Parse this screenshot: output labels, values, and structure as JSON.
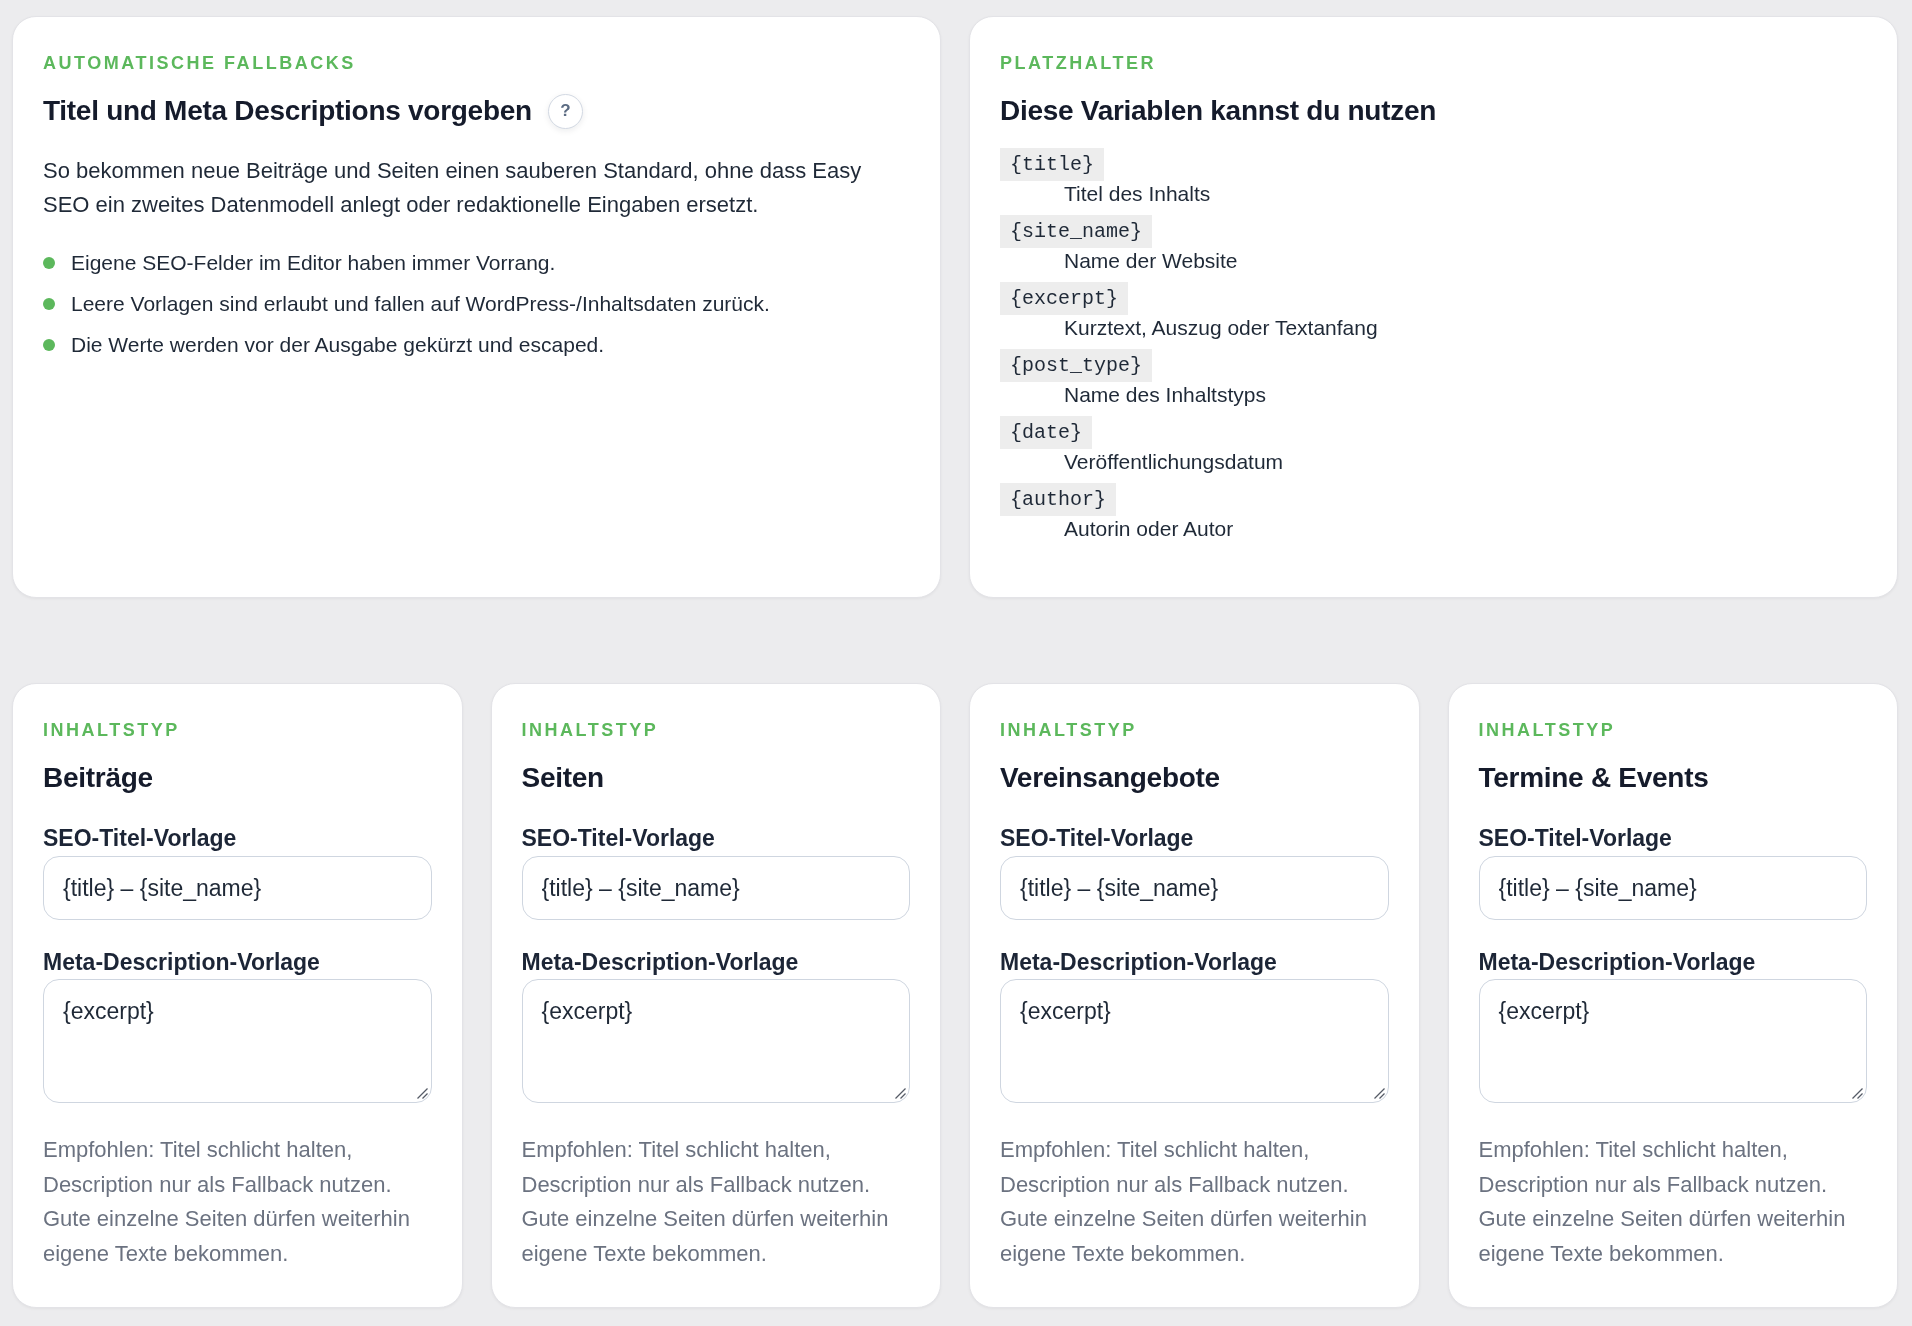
{
  "fallbacks_card": {
    "eyebrow": "AUTOMATISCHE FALLBACKS",
    "title": "Titel und Meta Descriptions vorgeben",
    "help_button": "?",
    "intro": "So bekommen neue Beiträge und Seiten einen sauberen Standard, ohne dass Easy SEO ein zweites Datenmodell anlegt oder redaktionelle Eingaben ersetzt.",
    "bullets": [
      "Eigene SEO-Felder im Editor haben immer Vorrang.",
      "Leere Vorlagen sind erlaubt und fallen auf WordPress-/Inhaltsdaten zurück.",
      "Die Werte werden vor der Ausgabe gekürzt und escaped."
    ]
  },
  "placeholders_card": {
    "eyebrow": "PLATZHALTER",
    "title": "Diese Variablen kannst du nutzen",
    "variables": [
      {
        "code": "{title}",
        "description": "Titel des Inhalts"
      },
      {
        "code": "{site_name}",
        "description": "Name der Website"
      },
      {
        "code": "{excerpt}",
        "description": "Kurztext, Auszug oder Textanfang"
      },
      {
        "code": "{post_type}",
        "description": "Name des Inhaltstyps"
      },
      {
        "code": "{date}",
        "description": "Veröffentlichungsdatum"
      },
      {
        "code": "{author}",
        "description": "Autorin oder Autor"
      }
    ]
  },
  "post_types": [
    {
      "eyebrow": "INHALTSTYP",
      "title": "Beiträge",
      "title_field": {
        "label": "SEO-Titel-Vorlage",
        "value": "{title} – {site_name}"
      },
      "description_field": {
        "label": "Meta-Description-Vorlage",
        "value": "{excerpt}"
      },
      "hint": "Empfohlen: Titel schlicht halten, Description nur als Fallback nutzen. Gute einzelne Seiten dürfen weiterhin eigene Texte bekommen."
    },
    {
      "eyebrow": "INHALTSTYP",
      "title": "Seiten",
      "title_field": {
        "label": "SEO-Titel-Vorlage",
        "value": "{title} – {site_name}"
      },
      "description_field": {
        "label": "Meta-Description-Vorlage",
        "value": "{excerpt}"
      },
      "hint": "Empfohlen: Titel schlicht halten, Description nur als Fallback nutzen. Gute einzelne Seiten dürfen weiterhin eigene Texte bekommen."
    },
    {
      "eyebrow": "INHALTSTYP",
      "title": "Vereinsangebote",
      "title_field": {
        "label": "SEO-Titel-Vorlage",
        "value": "{title} – {site_name}"
      },
      "description_field": {
        "label": "Meta-Description-Vorlage",
        "value": "{excerpt}"
      },
      "hint": "Empfohlen: Titel schlicht halten, Description nur als Fallback nutzen. Gute einzelne Seiten dürfen weiterhin eigene Texte bekommen."
    },
    {
      "eyebrow": "INHALTSTYP",
      "title": "Termine & Events",
      "title_field": {
        "label": "SEO-Titel-Vorlage",
        "value": "{title} – {site_name}"
      },
      "description_field": {
        "label": "Meta-Description-Vorlage",
        "value": "{excerpt}"
      },
      "hint": "Empfohlen: Titel schlicht halten, Description nur als Fallback nutzen. Gute einzelne Seiten dürfen weiterhin eigene Texte bekommen."
    }
  ]
}
